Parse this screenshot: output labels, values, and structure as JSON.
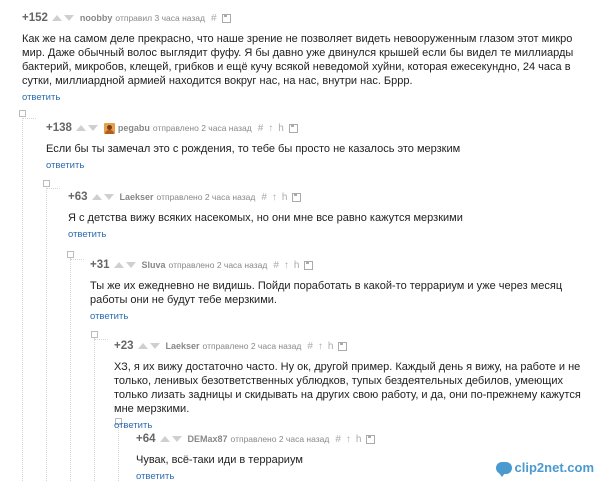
{
  "comments": [
    {
      "score": "+152",
      "author": "noobby",
      "time": "отправил 3 часа назад",
      "text": "Как же на самом деле прекрасно, что наше зрение не позволяет видеть невооруженным глазом этот микро мир. Даже обычный волос выглядит фуфу. Я бы давно уже двинулся крышей если бы видел те миллиарды бактерий, микробов, клещей, грибков и ещё кучу всякой неведомой хуйни, которая ежесекундно, 24 часа в сутки, миллиардной армией находится вокруг нас, на нас, внутри нас. Бррр.",
      "reply": "ответить"
    },
    {
      "score": "+138",
      "author": "pegabu",
      "time": "отправлено 2 часа назад",
      "text": "Если бы ты замечал это с рождения, то тебе бы просто не казалось это мерзким",
      "reply": "ответить"
    },
    {
      "score": "+63",
      "author": "Laekser",
      "time": "отправлено 2 часа назад",
      "text": "Я с детства вижу всяких насекомых, но они мне все равно кажутся мерзкими",
      "reply": "ответить"
    },
    {
      "score": "+31",
      "author": "Sluva",
      "time": "отправлено 2 часа назад",
      "text": "Ты же их ежедневно не видишь. Пойди поработать в какой-то террариум и уже через месяц работы они не будут тебе мерзкими.",
      "reply": "ответить"
    },
    {
      "score": "+23",
      "author": "Laekser",
      "time": "отправлено 2 часа назад",
      "text": "ХЗ, я их вижу достаточно часто. Ну ок, другой пример. Каждый день я вижу, на работе и не только, ленивых безответственных ублюдков, тупых бездеятельных дебилов, умеющих только лизать задницы и скидывать на других свою работу, и да, они по-прежнему кажутся мне мерзкими.",
      "reply": "ответить"
    },
    {
      "score": "+64",
      "author": "DEMax87",
      "time": "отправлено 2 часа назад",
      "text": "Чувак, всё-таки иди в террариум",
      "reply": "ответить"
    }
  ],
  "icons": {
    "hash": "#",
    "parent": "↑",
    "branch": "h",
    "save": "save-icon"
  },
  "watermark": "clip2net.com"
}
